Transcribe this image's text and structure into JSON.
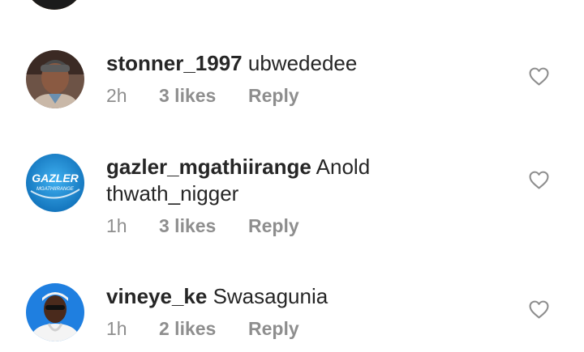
{
  "comments": [
    {
      "username": "stonner_1997",
      "text": "ubwededee",
      "time": "2h",
      "likes": "3 likes",
      "reply": "Reply"
    },
    {
      "username": "gazler_mgathiirange",
      "text": "Anold thwath_nigger",
      "time": "1h",
      "likes": "3 likes",
      "reply": "Reply",
      "avatar_logo_text": "GAZLER",
      "avatar_logo_subtext": "MGATHIIRANGE"
    },
    {
      "username": "vineye_ke",
      "text": "Swasagunia",
      "time": "1h",
      "likes": "2 likes",
      "reply": "Reply"
    }
  ],
  "icons": {
    "like": "heart-outline-icon"
  },
  "colors": {
    "text": "#262626",
    "meta": "#8e8e8e",
    "heart_stroke": "#8e8e8e",
    "avatar_ring_top": "#e89a4a",
    "gazler_bg": "#1e8fd8"
  }
}
